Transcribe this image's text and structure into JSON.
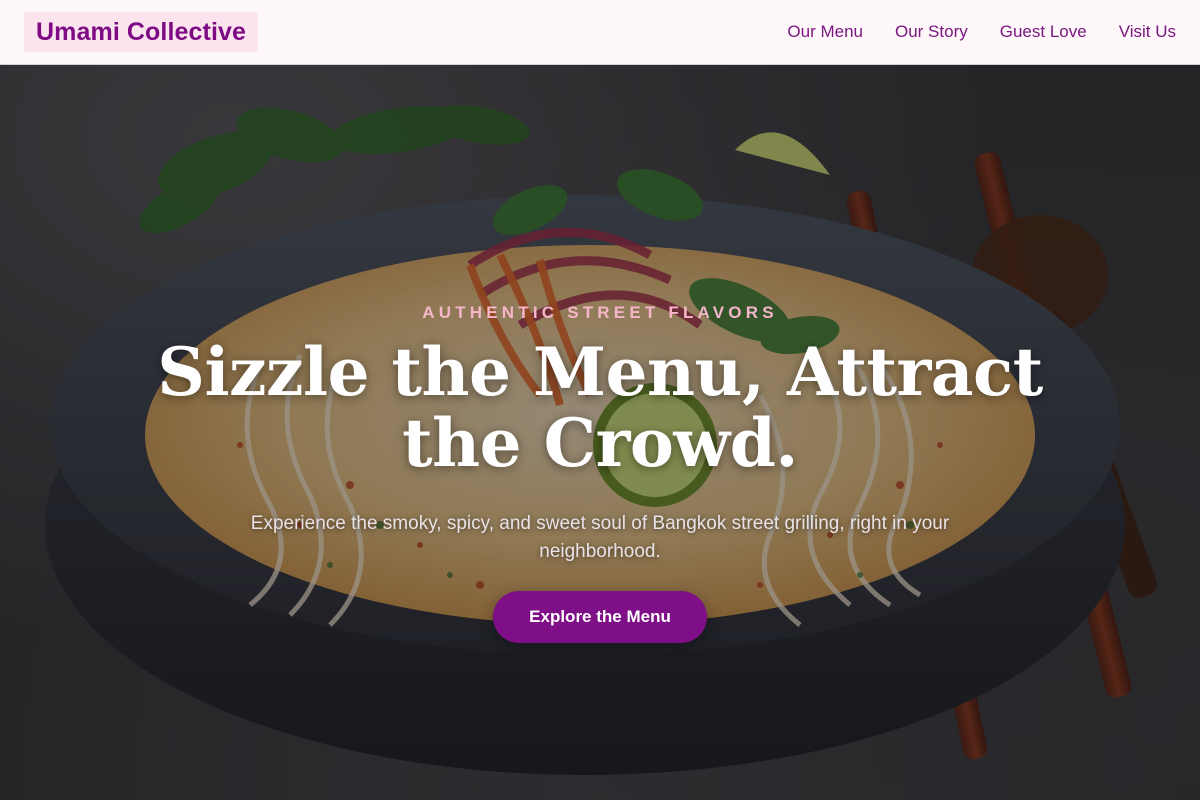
{
  "header": {
    "brand": "Umami Collective",
    "nav": [
      {
        "label": "Our Menu"
      },
      {
        "label": "Our Story"
      },
      {
        "label": "Guest Love"
      },
      {
        "label": "Visit Us"
      }
    ]
  },
  "hero": {
    "eyebrow": "AUTHENTIC STREET FLAVORS",
    "title": "Sizzle the Menu, Attract the Crowd.",
    "subtitle": "Experience the smoky, spicy, and sweet soul of Bangkok street grilling, right in your neighborhood.",
    "cta_label": "Explore the Menu",
    "image_subject": "noodle-soup-bowl-with-herbs-and-chopsticks"
  },
  "colors": {
    "brand_text": "#7e0a84",
    "brand_bg": "#fbe4ee",
    "nav_text": "#7a1780",
    "cta_bg": "#7e0f86",
    "eyebrow": "#f5b6c9",
    "header_bg": "#fff8fb"
  }
}
